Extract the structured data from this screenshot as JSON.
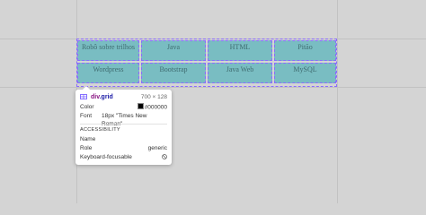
{
  "grid": {
    "cells": [
      [
        "Robô sobre trilhos",
        "Java",
        "HTML",
        "Pitão"
      ],
      [
        "Wordpress",
        "Bootstrap",
        "Java Web",
        "MySQL"
      ]
    ]
  },
  "tooltip": {
    "element": "div",
    "class_name": ".grid",
    "size": "700 × 128",
    "color_label": "Color",
    "color_value": "#000000",
    "font_label": "Font",
    "font_value": "18px \"Times New Roman\"",
    "accessibility_heading": "ACCESSIBILITY",
    "name_label": "Name",
    "name_value": "",
    "role_label": "Role",
    "role_value": "generic",
    "focusable_label": "Keyboard-focusable",
    "focusable_icon": "not-allowed-icon"
  },
  "colors": {
    "page_background": "#d4d4d4",
    "cell_fill": "#79bdc2",
    "cell_border": "#8a6bff",
    "cell_text": "#3f6c70"
  }
}
